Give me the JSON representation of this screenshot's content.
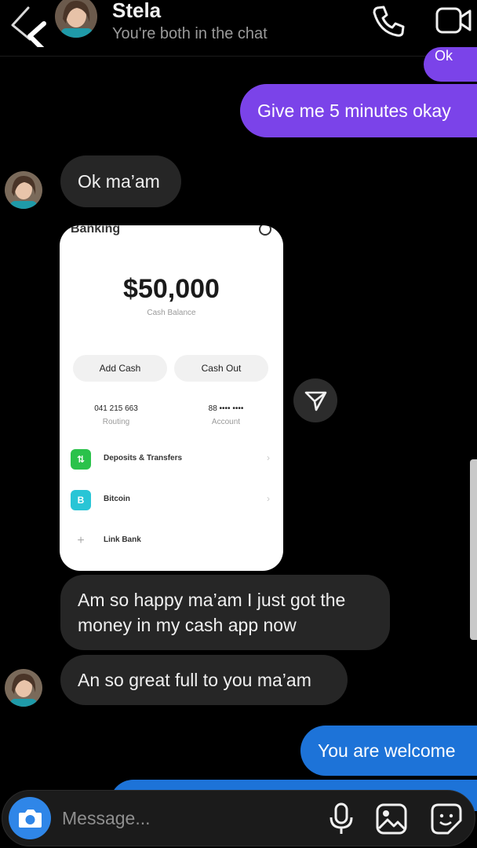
{
  "header": {
    "name": "Stela",
    "subtitle": "You're both in the chat"
  },
  "messages": {
    "sent_partial": "Ok",
    "msg1": "Give me 5 minutes okay",
    "msg2": "Ok ma’am",
    "msg3": "Am so happy ma’am I just got the money in my cash app now",
    "msg4": "An so great full to you ma’am",
    "msg5": "You are welcome"
  },
  "shared_image": {
    "title": "Banking",
    "balance": "$50,000",
    "balance_label": "Cash Balance",
    "add_cash": "Add Cash",
    "cash_out": "Cash Out",
    "routing_number": "041 215 663",
    "routing_label": "Routing",
    "account_number": "88 •••• ••••",
    "account_label": "Account",
    "rows": [
      {
        "label": "Deposits & Transfers",
        "icon": "⇅"
      },
      {
        "label": "Bitcoin",
        "icon": "B"
      },
      {
        "label": "Link Bank",
        "icon": "+"
      }
    ]
  },
  "composer": {
    "placeholder": "Message..."
  },
  "colors": {
    "sent_bubble": "#7b43e9",
    "received_bubble": "#262626",
    "blue_bubble": "#1d73d8",
    "camera": "#2f86e8"
  }
}
